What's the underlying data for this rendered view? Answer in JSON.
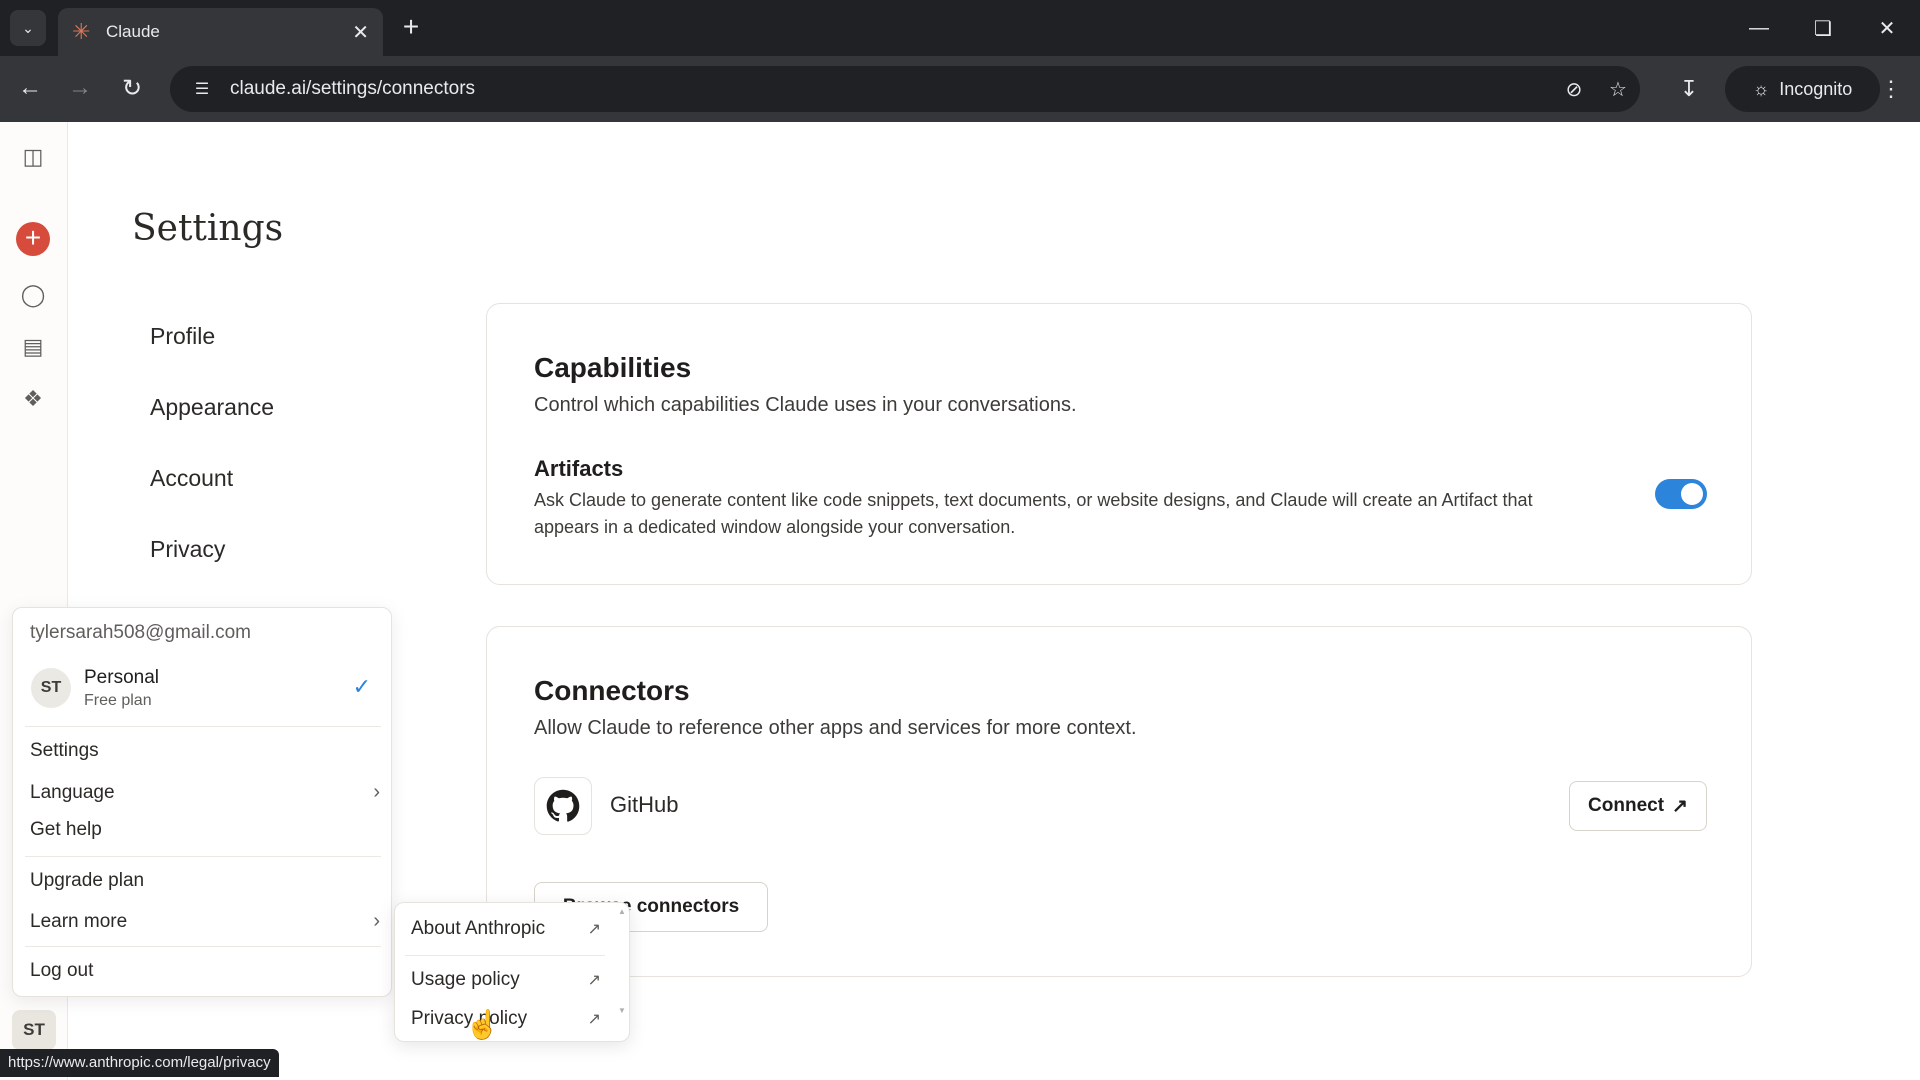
{
  "browser": {
    "tab_title": "Claude",
    "url": "claude.ai/settings/connectors",
    "incognito_label": "Incognito",
    "status_url": "https://www.anthropic.com/legal/privacy"
  },
  "settings": {
    "title": "Settings",
    "nav": [
      "Profile",
      "Appearance",
      "Account",
      "Privacy"
    ]
  },
  "capabilities": {
    "title": "Capabilities",
    "subtitle": "Control which capabilities Claude uses in your conversations.",
    "artifacts_title": "Artifacts",
    "artifacts_desc": "Ask Claude to generate content like code snippets, text documents, or website designs, and Claude will create an Artifact that appears in a dedicated window alongside your conversation.",
    "artifacts_enabled": true
  },
  "connectors": {
    "title": "Connectors",
    "subtitle": "Allow Claude to reference other apps and services for more context.",
    "github_label": "GitHub",
    "connect_label": "Connect",
    "browse_label": "Browse connectors"
  },
  "account_menu": {
    "email": "tylersarah508@gmail.com",
    "org_initials": "ST",
    "org_name": "Personal",
    "org_plan": "Free plan",
    "items": {
      "settings": "Settings",
      "language": "Language",
      "get_help": "Get help",
      "upgrade": "Upgrade plan",
      "learn_more": "Learn more",
      "logout": "Log out"
    }
  },
  "learn_more_menu": {
    "about": "About Anthropic",
    "usage": "Usage policy",
    "privacy": "Privacy policy"
  },
  "rail": {
    "avatar_initials": "ST"
  },
  "colors": {
    "accent": "#2c84db",
    "brand_new_chat": "#d64b3b"
  }
}
